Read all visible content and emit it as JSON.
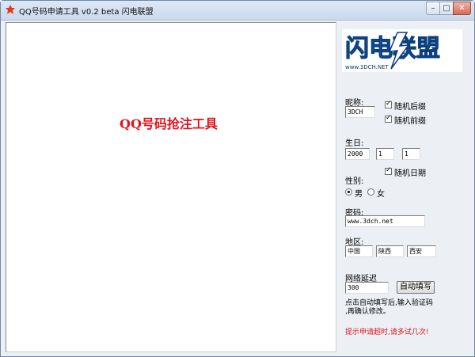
{
  "window": {
    "title": "QQ号码申请工具 v0.2 beta   闪电联盟"
  },
  "main": {
    "headline": "QQ号码抢注工具"
  },
  "logo": {
    "text": "闪电联盟",
    "url": "www.3DCH.NET"
  },
  "form": {
    "nickname_label": "昵称:",
    "nickname_value": "3DCH",
    "random_suffix_label": "随机后缀",
    "random_prefix_label": "随机前缀",
    "birthday_label": "生日:",
    "birth_year": "2000",
    "birth_month": "1",
    "birth_day": "1",
    "random_date_label": "随机日期",
    "gender_label": "性别:",
    "gender_male": "男",
    "gender_female": "女",
    "password_label": "密码:",
    "password_value": "www.3dch.net",
    "region_label": "地区:",
    "region_country": "中国",
    "region_province": "陕西",
    "region_city": "西安",
    "delay_label": "网络延迟",
    "delay_value": "300",
    "autofill_button": "自动填写",
    "hint_line1": "点击自动填写后,输入验证码",
    "hint_line2": ",再确认修改。",
    "warning": "提示申请超时,请多试几次!"
  },
  "colors": {
    "accent_red": "#e0141e",
    "logo_blue": "#1f6fc4"
  }
}
